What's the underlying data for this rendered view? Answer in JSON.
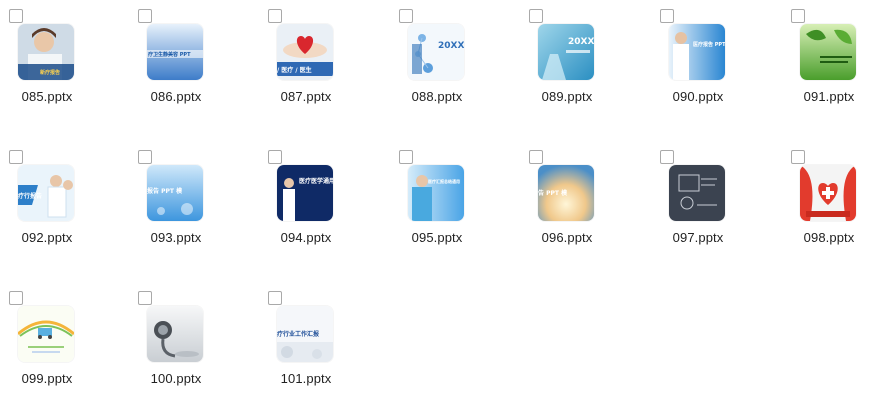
{
  "files": [
    {
      "name": "085.pptx",
      "theme": "doctor-photo",
      "thumb_text": "新疗报告"
    },
    {
      "name": "086.pptx",
      "theme": "blue-text",
      "thumb_text": "疗卫生静美容 PPT"
    },
    {
      "name": "087.pptx",
      "theme": "heart-hands",
      "thumb_text": "/ 医疗 / 医生"
    },
    {
      "name": "088.pptx",
      "theme": "molecule",
      "thumb_text": "20XX"
    },
    {
      "name": "089.pptx",
      "theme": "lab-glass",
      "thumb_text": "20XX"
    },
    {
      "name": "090.pptx",
      "theme": "blue-doctor",
      "thumb_text": "医疗报告 PPT"
    },
    {
      "name": "091.pptx",
      "theme": "green-leaf",
      "thumb_text": ""
    },
    {
      "name": "092.pptx",
      "theme": "doctor-group",
      "thumb_text": "疗行报告"
    },
    {
      "name": "093.pptx",
      "theme": "blue-bokeh",
      "thumb_text": "报告 PPT 模"
    },
    {
      "name": "094.pptx",
      "theme": "dark-navy",
      "thumb_text": "医疗医学通用"
    },
    {
      "name": "095.pptx",
      "theme": "nurse-blue",
      "thumb_text": "医疗汇报总结通用"
    },
    {
      "name": "096.pptx",
      "theme": "sunlight",
      "thumb_text": "告 PPT 模"
    },
    {
      "name": "097.pptx",
      "theme": "chalkboard",
      "thumb_text": ""
    },
    {
      "name": "098.pptx",
      "theme": "red-cross",
      "thumb_text": ""
    },
    {
      "name": "099.pptx",
      "theme": "cartoon",
      "thumb_text": ""
    },
    {
      "name": "100.pptx",
      "theme": "stethoscope",
      "thumb_text": ""
    },
    {
      "name": "101.pptx",
      "theme": "light-text",
      "thumb_text": "疗行业工作汇报"
    }
  ]
}
